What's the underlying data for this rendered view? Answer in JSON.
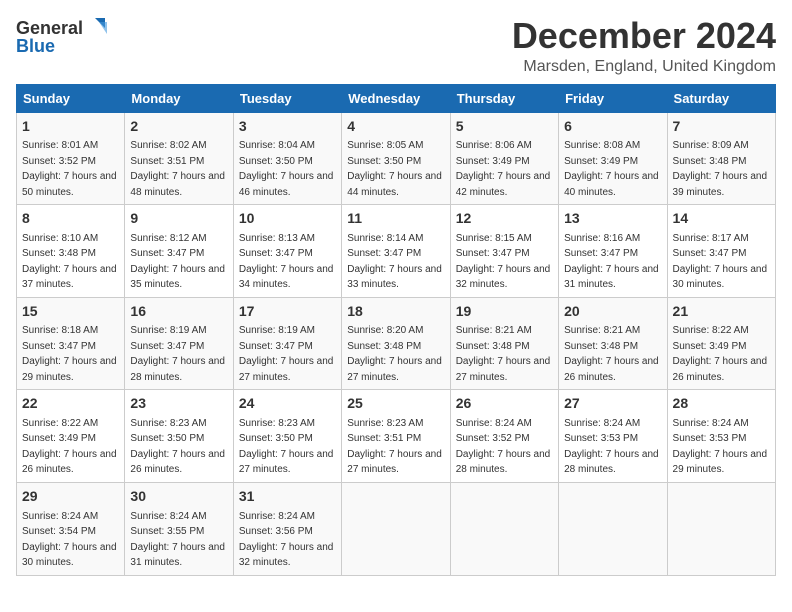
{
  "header": {
    "logo_general": "General",
    "logo_blue": "Blue",
    "month": "December 2024",
    "location": "Marsden, England, United Kingdom"
  },
  "days_of_week": [
    "Sunday",
    "Monday",
    "Tuesday",
    "Wednesday",
    "Thursday",
    "Friday",
    "Saturday"
  ],
  "weeks": [
    [
      {
        "day": "1",
        "sunrise": "Sunrise: 8:01 AM",
        "sunset": "Sunset: 3:52 PM",
        "daylight": "Daylight: 7 hours and 50 minutes."
      },
      {
        "day": "2",
        "sunrise": "Sunrise: 8:02 AM",
        "sunset": "Sunset: 3:51 PM",
        "daylight": "Daylight: 7 hours and 48 minutes."
      },
      {
        "day": "3",
        "sunrise": "Sunrise: 8:04 AM",
        "sunset": "Sunset: 3:50 PM",
        "daylight": "Daylight: 7 hours and 46 minutes."
      },
      {
        "day": "4",
        "sunrise": "Sunrise: 8:05 AM",
        "sunset": "Sunset: 3:50 PM",
        "daylight": "Daylight: 7 hours and 44 minutes."
      },
      {
        "day": "5",
        "sunrise": "Sunrise: 8:06 AM",
        "sunset": "Sunset: 3:49 PM",
        "daylight": "Daylight: 7 hours and 42 minutes."
      },
      {
        "day": "6",
        "sunrise": "Sunrise: 8:08 AM",
        "sunset": "Sunset: 3:49 PM",
        "daylight": "Daylight: 7 hours and 40 minutes."
      },
      {
        "day": "7",
        "sunrise": "Sunrise: 8:09 AM",
        "sunset": "Sunset: 3:48 PM",
        "daylight": "Daylight: 7 hours and 39 minutes."
      }
    ],
    [
      {
        "day": "8",
        "sunrise": "Sunrise: 8:10 AM",
        "sunset": "Sunset: 3:48 PM",
        "daylight": "Daylight: 7 hours and 37 minutes."
      },
      {
        "day": "9",
        "sunrise": "Sunrise: 8:12 AM",
        "sunset": "Sunset: 3:47 PM",
        "daylight": "Daylight: 7 hours and 35 minutes."
      },
      {
        "day": "10",
        "sunrise": "Sunrise: 8:13 AM",
        "sunset": "Sunset: 3:47 PM",
        "daylight": "Daylight: 7 hours and 34 minutes."
      },
      {
        "day": "11",
        "sunrise": "Sunrise: 8:14 AM",
        "sunset": "Sunset: 3:47 PM",
        "daylight": "Daylight: 7 hours and 33 minutes."
      },
      {
        "day": "12",
        "sunrise": "Sunrise: 8:15 AM",
        "sunset": "Sunset: 3:47 PM",
        "daylight": "Daylight: 7 hours and 32 minutes."
      },
      {
        "day": "13",
        "sunrise": "Sunrise: 8:16 AM",
        "sunset": "Sunset: 3:47 PM",
        "daylight": "Daylight: 7 hours and 31 minutes."
      },
      {
        "day": "14",
        "sunrise": "Sunrise: 8:17 AM",
        "sunset": "Sunset: 3:47 PM",
        "daylight": "Daylight: 7 hours and 30 minutes."
      }
    ],
    [
      {
        "day": "15",
        "sunrise": "Sunrise: 8:18 AM",
        "sunset": "Sunset: 3:47 PM",
        "daylight": "Daylight: 7 hours and 29 minutes."
      },
      {
        "day": "16",
        "sunrise": "Sunrise: 8:19 AM",
        "sunset": "Sunset: 3:47 PM",
        "daylight": "Daylight: 7 hours and 28 minutes."
      },
      {
        "day": "17",
        "sunrise": "Sunrise: 8:19 AM",
        "sunset": "Sunset: 3:47 PM",
        "daylight": "Daylight: 7 hours and 27 minutes."
      },
      {
        "day": "18",
        "sunrise": "Sunrise: 8:20 AM",
        "sunset": "Sunset: 3:48 PM",
        "daylight": "Daylight: 7 hours and 27 minutes."
      },
      {
        "day": "19",
        "sunrise": "Sunrise: 8:21 AM",
        "sunset": "Sunset: 3:48 PM",
        "daylight": "Daylight: 7 hours and 27 minutes."
      },
      {
        "day": "20",
        "sunrise": "Sunrise: 8:21 AM",
        "sunset": "Sunset: 3:48 PM",
        "daylight": "Daylight: 7 hours and 26 minutes."
      },
      {
        "day": "21",
        "sunrise": "Sunrise: 8:22 AM",
        "sunset": "Sunset: 3:49 PM",
        "daylight": "Daylight: 7 hours and 26 minutes."
      }
    ],
    [
      {
        "day": "22",
        "sunrise": "Sunrise: 8:22 AM",
        "sunset": "Sunset: 3:49 PM",
        "daylight": "Daylight: 7 hours and 26 minutes."
      },
      {
        "day": "23",
        "sunrise": "Sunrise: 8:23 AM",
        "sunset": "Sunset: 3:50 PM",
        "daylight": "Daylight: 7 hours and 26 minutes."
      },
      {
        "day": "24",
        "sunrise": "Sunrise: 8:23 AM",
        "sunset": "Sunset: 3:50 PM",
        "daylight": "Daylight: 7 hours and 27 minutes."
      },
      {
        "day": "25",
        "sunrise": "Sunrise: 8:23 AM",
        "sunset": "Sunset: 3:51 PM",
        "daylight": "Daylight: 7 hours and 27 minutes."
      },
      {
        "day": "26",
        "sunrise": "Sunrise: 8:24 AM",
        "sunset": "Sunset: 3:52 PM",
        "daylight": "Daylight: 7 hours and 28 minutes."
      },
      {
        "day": "27",
        "sunrise": "Sunrise: 8:24 AM",
        "sunset": "Sunset: 3:53 PM",
        "daylight": "Daylight: 7 hours and 28 minutes."
      },
      {
        "day": "28",
        "sunrise": "Sunrise: 8:24 AM",
        "sunset": "Sunset: 3:53 PM",
        "daylight": "Daylight: 7 hours and 29 minutes."
      }
    ],
    [
      {
        "day": "29",
        "sunrise": "Sunrise: 8:24 AM",
        "sunset": "Sunset: 3:54 PM",
        "daylight": "Daylight: 7 hours and 30 minutes."
      },
      {
        "day": "30",
        "sunrise": "Sunrise: 8:24 AM",
        "sunset": "Sunset: 3:55 PM",
        "daylight": "Daylight: 7 hours and 31 minutes."
      },
      {
        "day": "31",
        "sunrise": "Sunrise: 8:24 AM",
        "sunset": "Sunset: 3:56 PM",
        "daylight": "Daylight: 7 hours and 32 minutes."
      },
      null,
      null,
      null,
      null
    ]
  ]
}
